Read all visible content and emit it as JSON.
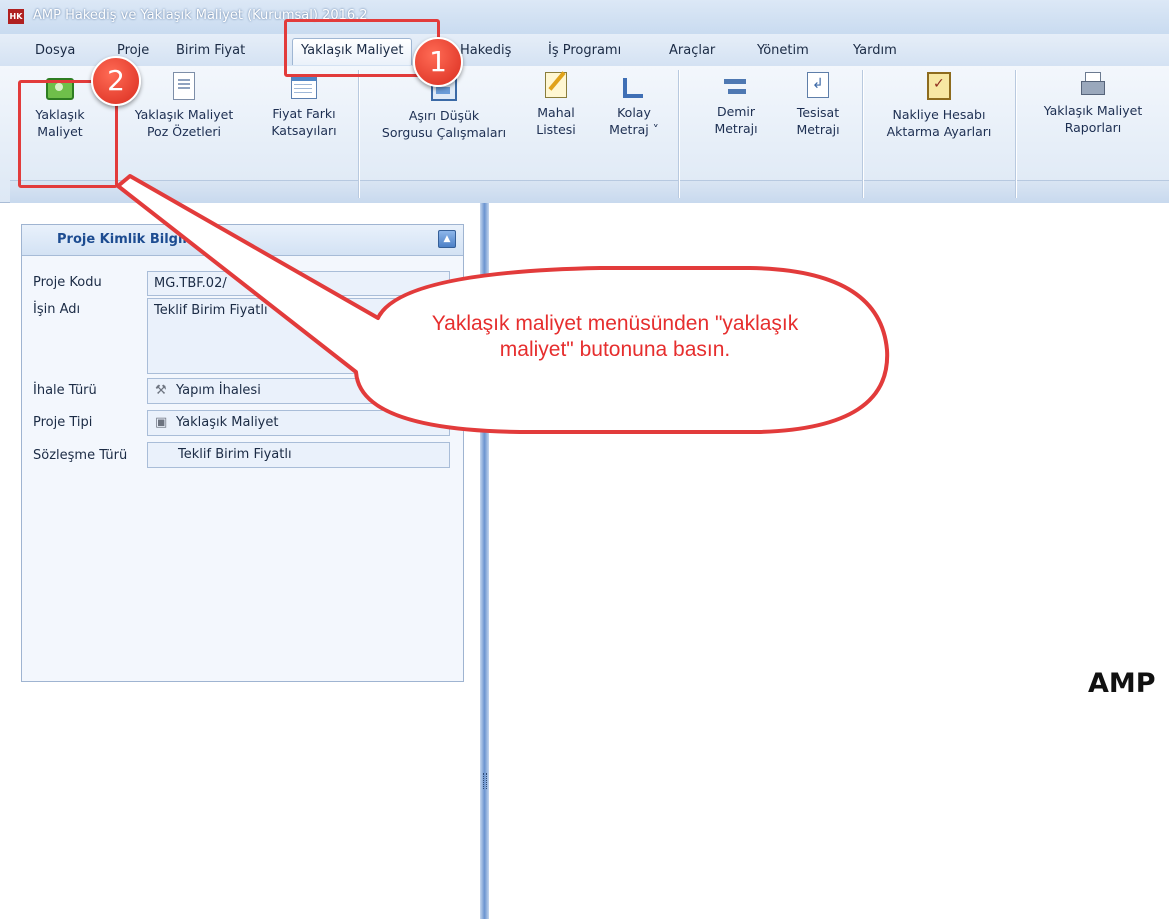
{
  "window": {
    "title": "AMP Hakediş ve Yaklaşık Maliyet (Kurumsal) 2016.2",
    "app_icon": "HK"
  },
  "menu": {
    "items": [
      "Dosya",
      "Proje",
      "Birim Fiyat",
      "Yaklaşık Maliyet",
      "Hakediş",
      "İş Programı",
      "Araçlar",
      "Yönetim",
      "Yardım"
    ],
    "active_index": 3
  },
  "ribbon": {
    "buttons": [
      {
        "line1": "Yaklaşık",
        "line2": "Maliyet",
        "icon": "money-icon"
      },
      {
        "line1": "Yaklaşık Maliyet",
        "line2": "Poz Özetleri",
        "icon": "document-icon"
      },
      {
        "line1": "Fiyat Farkı",
        "line2": "Katsayıları",
        "icon": "table-icon"
      },
      {
        "line1": "Aşırı Düşük",
        "line2": "Sorgusu Çalışmaları",
        "icon": "screen-icon"
      },
      {
        "line1": "Mahal",
        "line2": "Listesi",
        "icon": "edit-icon"
      },
      {
        "line1": "Kolay",
        "line2": "Metraj ˅",
        "icon": "ruler-icon"
      },
      {
        "line1": "Demir",
        "line2": "Metrajı",
        "icon": "bars-icon"
      },
      {
        "line1": "Tesisat",
        "line2": "Metrajı",
        "icon": "flow-icon"
      },
      {
        "line1": "Nakliye Hesabı",
        "line2": "Aktarma Ayarları",
        "icon": "clipboard-icon"
      },
      {
        "line1": "Yaklaşık Maliyet",
        "line2": "Raporları",
        "icon": "printer-icon"
      }
    ]
  },
  "project_panel": {
    "title": "Proje Kimlik Bilgileri",
    "fields": [
      {
        "label": "Proje Kodu",
        "value": "MG.TBF.02/"
      },
      {
        "label": "İşin Adı",
        "value": "Teklif Birim Fiyatlı"
      },
      {
        "label": "İhale Türü",
        "value": "Yapım İhalesi",
        "icon": "tools-icon"
      },
      {
        "label": "Proje Tipi",
        "value": "Yaklaşık Maliyet",
        "icon": "project-icon"
      },
      {
        "label": "Sözleşme Türü",
        "value": "Teklif Birim Fiyatlı"
      }
    ]
  },
  "main": {
    "brand_text": "AMP"
  },
  "annotations": {
    "badge1": "1",
    "badge2": "2",
    "bubble_text": "Yaklaşık maliyet menüsünden \"yaklaşık maliyet\" butonuna basın.",
    "color": "#e23b3b"
  }
}
